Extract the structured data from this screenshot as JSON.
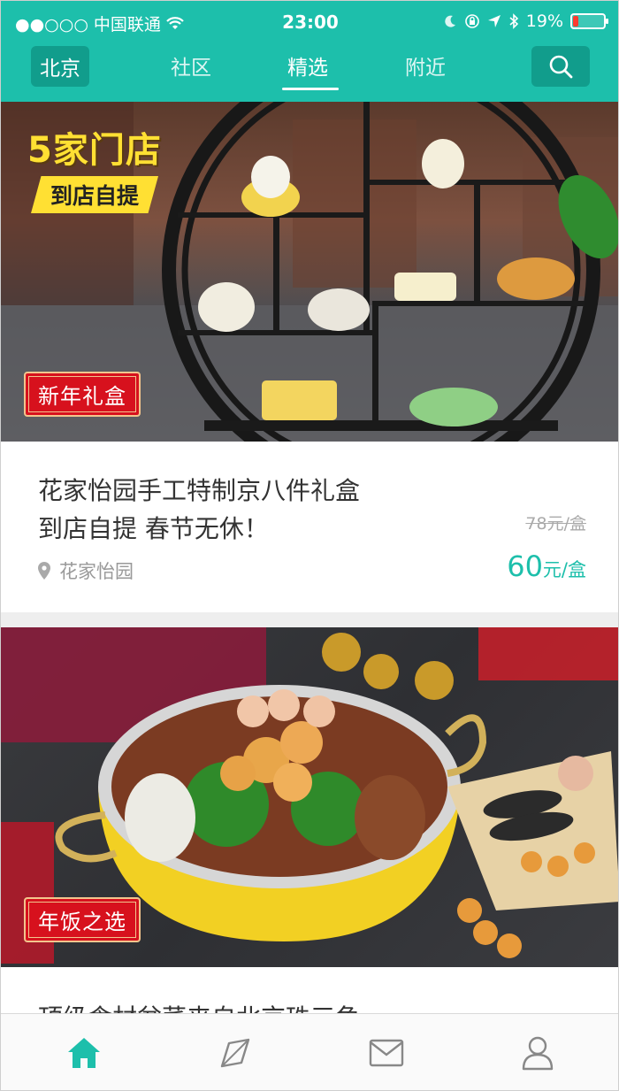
{
  "status_bar": {
    "carrier": "●●○○○ 中国联通",
    "time": "23:00",
    "battery": "19%",
    "battery_level": 0.19
  },
  "nav": {
    "city": "北京",
    "tabs": [
      {
        "label": "社区"
      },
      {
        "label": "精选"
      },
      {
        "label": "附近"
      }
    ],
    "active_tab": "精选"
  },
  "cards": [
    {
      "badge_big": "5家门店",
      "badge_small": "到店自提",
      "tag": "新年礼盒",
      "title_line1": "花家怡园手工特制京八件礼盒",
      "title_line2": "到店自提 春节无休！",
      "old_price": "78元/盒",
      "location": "花家怡园",
      "price_num": "60",
      "price_unit": "元/盒"
    },
    {
      "tag": "年饭之选",
      "title": "顶级食材盆菜来自北京珠三角"
    }
  ],
  "tab_bar": {
    "items": [
      "home",
      "discover",
      "messages",
      "profile"
    ],
    "active": "home"
  },
  "colors": {
    "brand": "#1dbfab",
    "brand_dark": "#119d8c",
    "tag_red": "#d7111d",
    "badge_yellow": "#ffe033"
  }
}
